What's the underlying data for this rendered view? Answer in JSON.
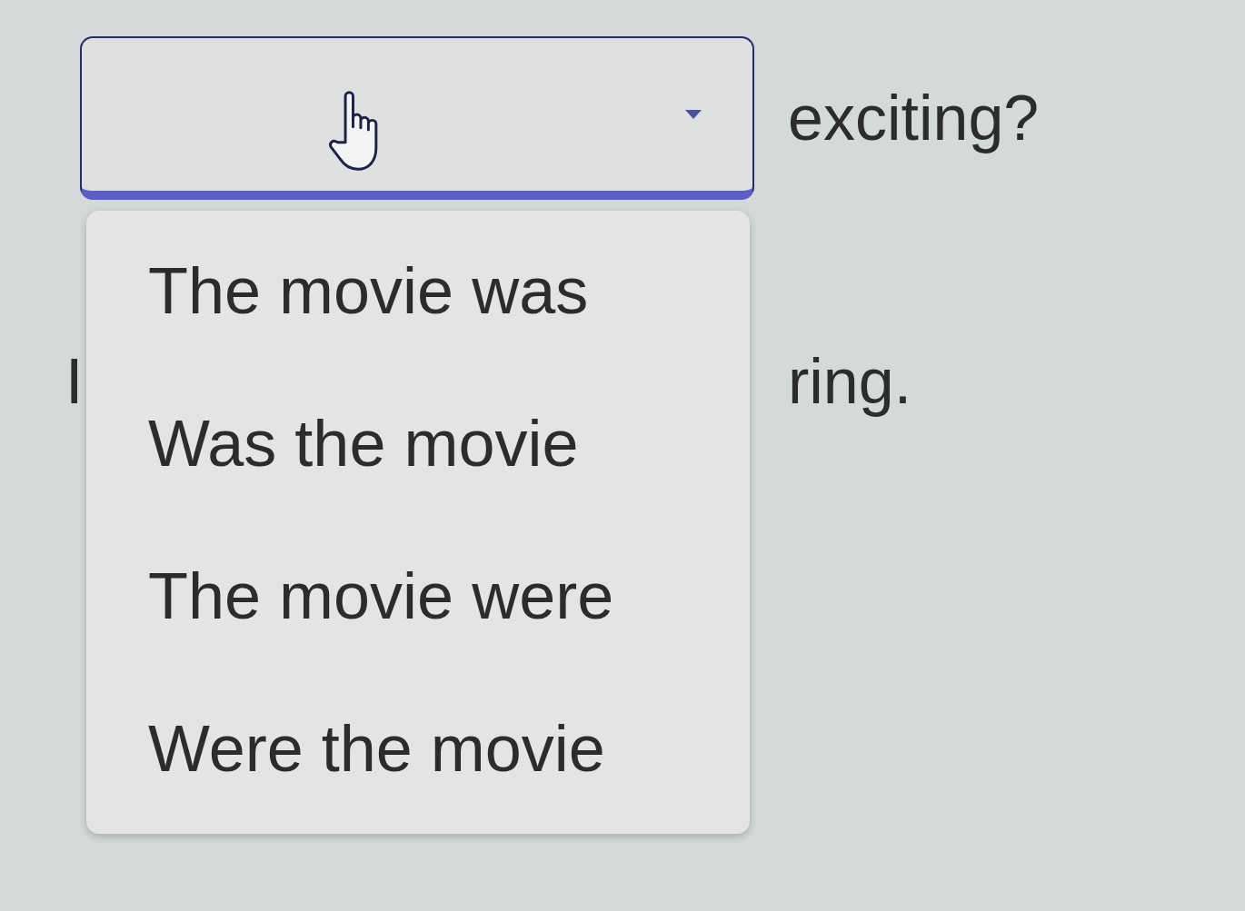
{
  "questions": [
    {
      "parts": [
        {
          "kind": "select",
          "expanded": true,
          "options": [
            {
              "label": "The movie was",
              "selected": false
            },
            {
              "label": "Was the movie",
              "selected": false
            },
            {
              "label": "The movie were",
              "selected": false
            },
            {
              "label": "Were the movie",
              "selected": false
            }
          ]
        },
        {
          "kind": "text",
          "text": "exciting?"
        }
      ]
    },
    {
      "parts": [
        {
          "kind": "text",
          "text": "I"
        },
        {
          "kind": "text",
          "text": "ring."
        }
      ]
    }
  ]
}
